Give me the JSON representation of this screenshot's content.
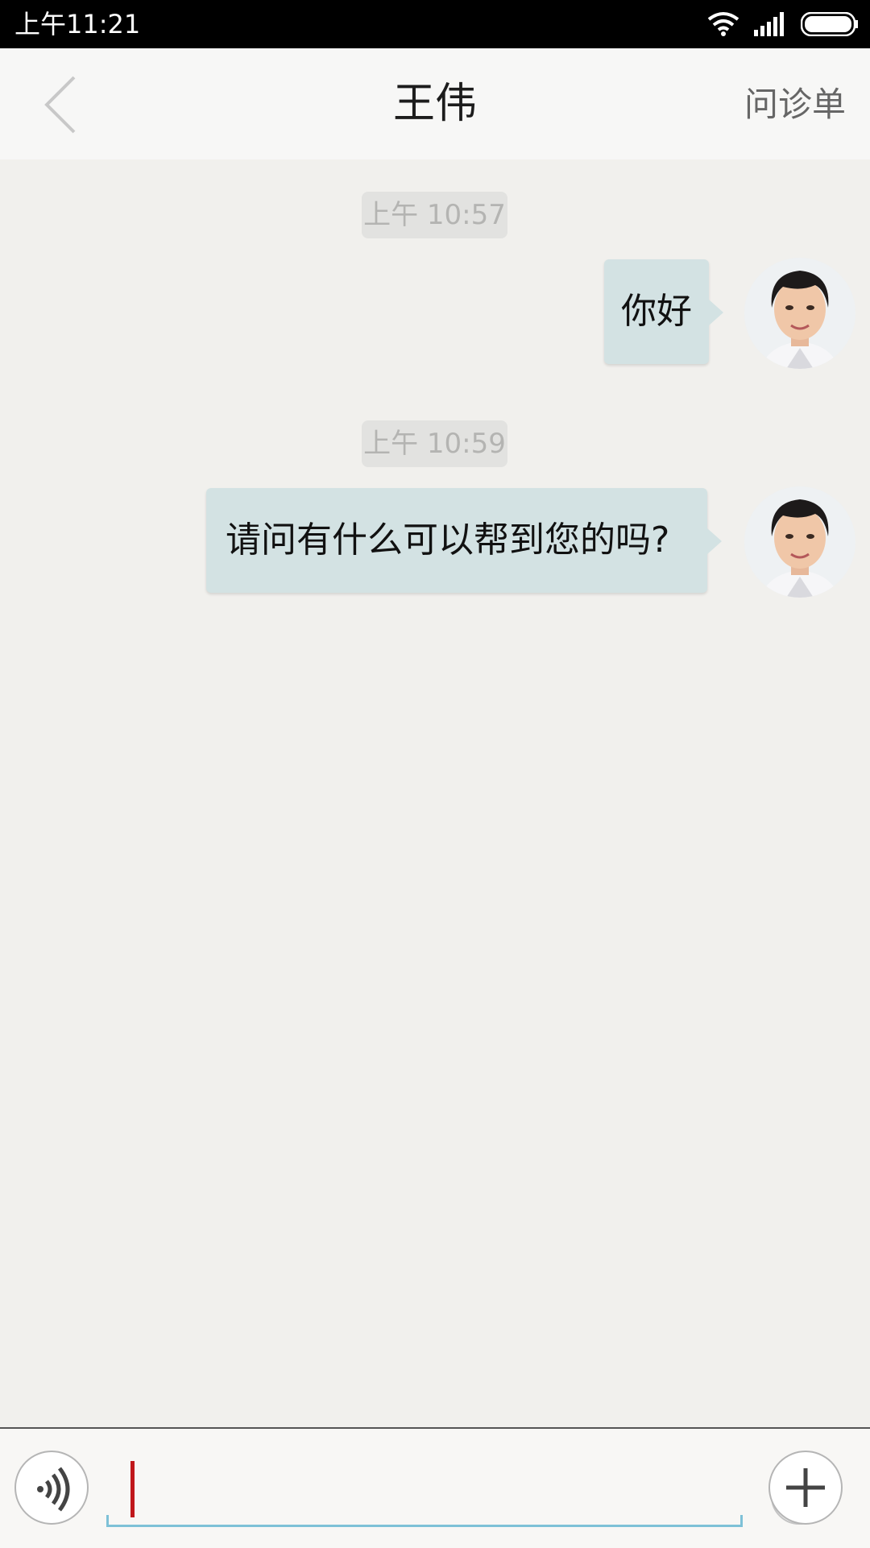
{
  "status_bar": {
    "time": "上午11:21"
  },
  "header": {
    "title": "王伟",
    "right_link": "问诊单"
  },
  "messages": [
    {
      "timestamp": "上午 10:57",
      "text": "你好"
    },
    {
      "timestamp": "上午 10:59",
      "text": "请问有什么可以帮到您的吗?"
    }
  ],
  "input": {
    "value": ""
  },
  "colors": {
    "bubble": "#d3e2e3",
    "background": "#f1f0ed",
    "cursor": "#c0171b",
    "underline": "#7ec1d7"
  }
}
